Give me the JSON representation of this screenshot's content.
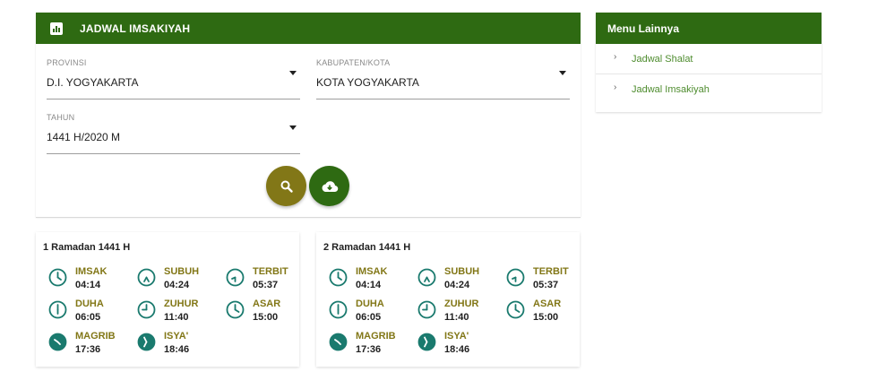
{
  "main_card": {
    "title": "JADWAL IMSAKIYAH",
    "title_icon": "bar-chart-icon",
    "provinsi": {
      "label": "PROVINSI",
      "value": "D.I. YOGYAKARTA"
    },
    "kabupaten": {
      "label": "KABUPATEN/KOTA",
      "value": "KOTA YOGYAKARTA"
    },
    "tahun": {
      "label": "TAHUN",
      "value": "1441 H/2020 M"
    },
    "search_icon": "search-icon",
    "download_icon": "cloud-download-icon"
  },
  "menu": {
    "title": "Menu Lainnya",
    "items": [
      {
        "label": "Jadwal Shalat",
        "icon": "chevron-right-icon"
      },
      {
        "label": "Jadwal Imsakiyah",
        "icon": "chevron-right-icon"
      }
    ]
  },
  "days": [
    {
      "title": "1 Ramadan 1441 H",
      "prayers": [
        {
          "name": "IMSAK",
          "time": "04:14"
        },
        {
          "name": "SUBUH",
          "time": "04:24"
        },
        {
          "name": "TERBIT",
          "time": "05:37"
        },
        {
          "name": "DUHA",
          "time": "06:05"
        },
        {
          "name": "ZUHUR",
          "time": "11:40"
        },
        {
          "name": "ASAR",
          "time": "15:00"
        },
        {
          "name": "MAGRIB",
          "time": "17:36"
        },
        {
          "name": "ISYA'",
          "time": "18:46"
        }
      ]
    },
    {
      "title": "2 Ramadan 1441 H",
      "prayers": [
        {
          "name": "IMSAK",
          "time": "04:14"
        },
        {
          "name": "SUBUH",
          "time": "04:24"
        },
        {
          "name": "TERBIT",
          "time": "05:37"
        },
        {
          "name": "DUHA",
          "time": "06:05"
        },
        {
          "name": "ZUHUR",
          "time": "11:40"
        },
        {
          "name": "ASAR",
          "time": "15:00"
        },
        {
          "name": "MAGRIB",
          "time": "17:36"
        },
        {
          "name": "ISYA'",
          "time": "18:46"
        }
      ]
    }
  ],
  "colors": {
    "primary_green": "#2e6a12",
    "olive": "#827717",
    "teal": "#1a7a6e",
    "link_green": "#4e8c2e"
  }
}
